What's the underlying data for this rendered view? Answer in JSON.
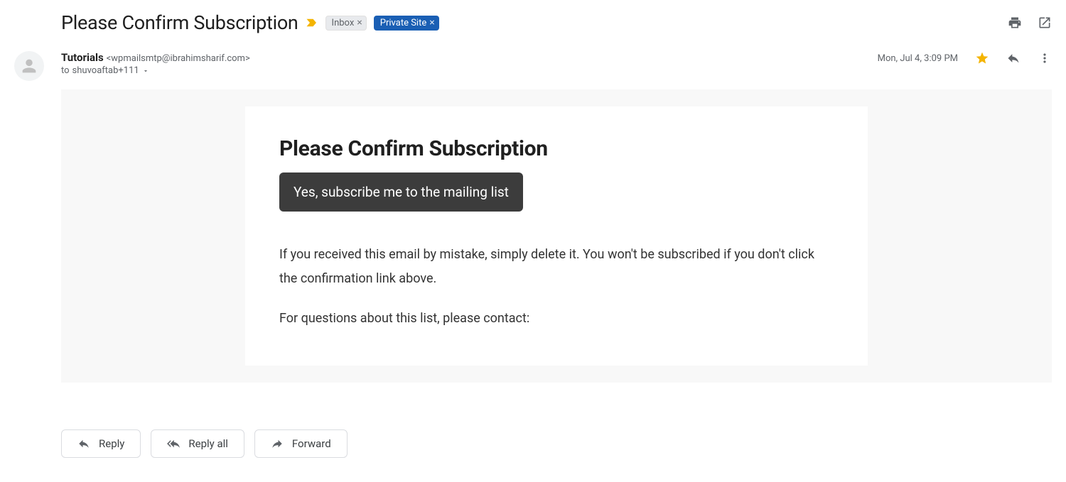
{
  "header": {
    "subject": "Please Confirm Subscription",
    "labels": [
      {
        "text": "Inbox",
        "style": "inbox"
      },
      {
        "text": "Private Site",
        "style": "private"
      }
    ]
  },
  "meta": {
    "from_name": "Tutorials",
    "from_email": "<wpmailsmtp@ibrahimsharif.com>",
    "to_prefix": "to",
    "to_recipient": "shuvoaftab+111",
    "date": "Mon, Jul 4, 3:09 PM"
  },
  "body": {
    "title": "Please Confirm Subscription",
    "confirm_button": "Yes, subscribe me to the mailing list",
    "paragraph1": "If you received this email by mistake, simply delete it. You won't be subscribed if you don't click the confirmation link above.",
    "paragraph2": "For questions about this list, please contact:"
  },
  "actions": {
    "reply": "Reply",
    "reply_all": "Reply all",
    "forward": "Forward"
  }
}
